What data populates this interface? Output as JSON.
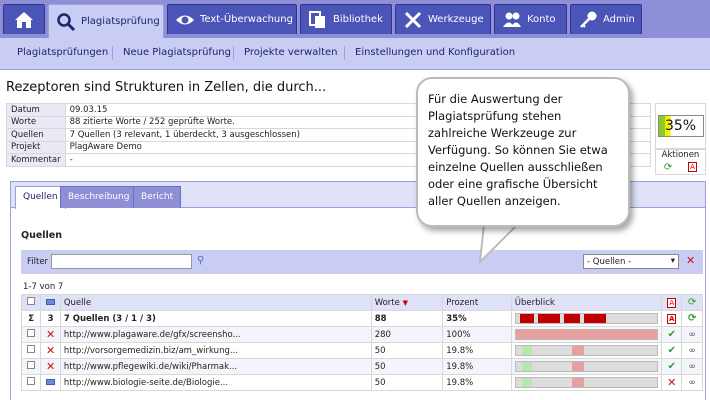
{
  "nav": {
    "tabs": [
      {
        "label": "",
        "icon": "home-icon"
      },
      {
        "label": "Plagiatsprüfung",
        "icon": "magnifier-icon"
      },
      {
        "label": "Text-Überwachung",
        "icon": "eye-icon"
      },
      {
        "label": "Bibliothek",
        "icon": "documents-icon"
      },
      {
        "label": "Werkzeuge",
        "icon": "tools-icon"
      },
      {
        "label": "Konto",
        "icon": "users-icon"
      },
      {
        "label": "Admin",
        "icon": "key-icon"
      }
    ],
    "subnav": [
      "Plagiatsprüfungen",
      "Neue Plagiatsprüfung",
      "Projekte verwalten",
      "Einstellungen und Konfiguration"
    ]
  },
  "page_title": "Rezeptoren sind Strukturen in Zellen, die durch...",
  "info": {
    "rows": [
      {
        "key": "Datum",
        "value": "09.03.15"
      },
      {
        "key": "Worte",
        "value": "88 zitierte Worte / 252 geprüfte Worte."
      },
      {
        "key": "Quellen",
        "value": "7 Quellen (3 relevant, 1 überdeckt, 3 ausgeschlossen)"
      },
      {
        "key": "Projekt",
        "value": "PlagAware Demo"
      },
      {
        "key": "Kommentar",
        "value": "-"
      }
    ],
    "score": "35%",
    "score_fraction": 0.35,
    "actions_label": "Aktionen"
  },
  "tabs": [
    "Quellen",
    "Beschreibung",
    "Bericht"
  ],
  "section_title": "Quellen",
  "filter": {
    "label": "Filter",
    "placeholder": "",
    "select_value": "- Quellen -"
  },
  "count_text": "1-7 von 7",
  "table": {
    "headers": {
      "source": "Quelle",
      "words": "Worte",
      "percent": "Prozent",
      "overview": "Überblick"
    },
    "sum": {
      "sigma": "Σ",
      "n": "3",
      "source": "7 Quellen (3 / 1 / 3)",
      "words": "88",
      "percent": "35%"
    },
    "rows": [
      {
        "source": "http://www.plagaware.de/gfx/screensho...",
        "words": "280",
        "percent": "100%",
        "status": "excluded"
      },
      {
        "source": "http://vorsorgemedizin.biz/am_wirkung...",
        "words": "50",
        "percent": "19.8%",
        "status": "excluded"
      },
      {
        "source": "http://www.pflegewiki.de/wiki/Pharmak...",
        "words": "50",
        "percent": "19.8%",
        "status": "excluded"
      },
      {
        "source": "http://www.biologie-seite.de/Biologie...",
        "words": "50",
        "percent": "19.8%",
        "status": "relevant"
      }
    ]
  },
  "balloon_text": "Für die Auswertung der Plagiatsprüfung stehen zahlreiche Werkzeuge zur Verfügung. So können Sie etwa einzelne Quellen ausschließen oder eine grafische Übersicht aller Quellen anzeigen.",
  "colors": {
    "nav": "#8f8fd8",
    "tab": "#4b55b8",
    "subnav": "#c9cdf4",
    "match": "#c00000",
    "excluded": "#d01010"
  }
}
